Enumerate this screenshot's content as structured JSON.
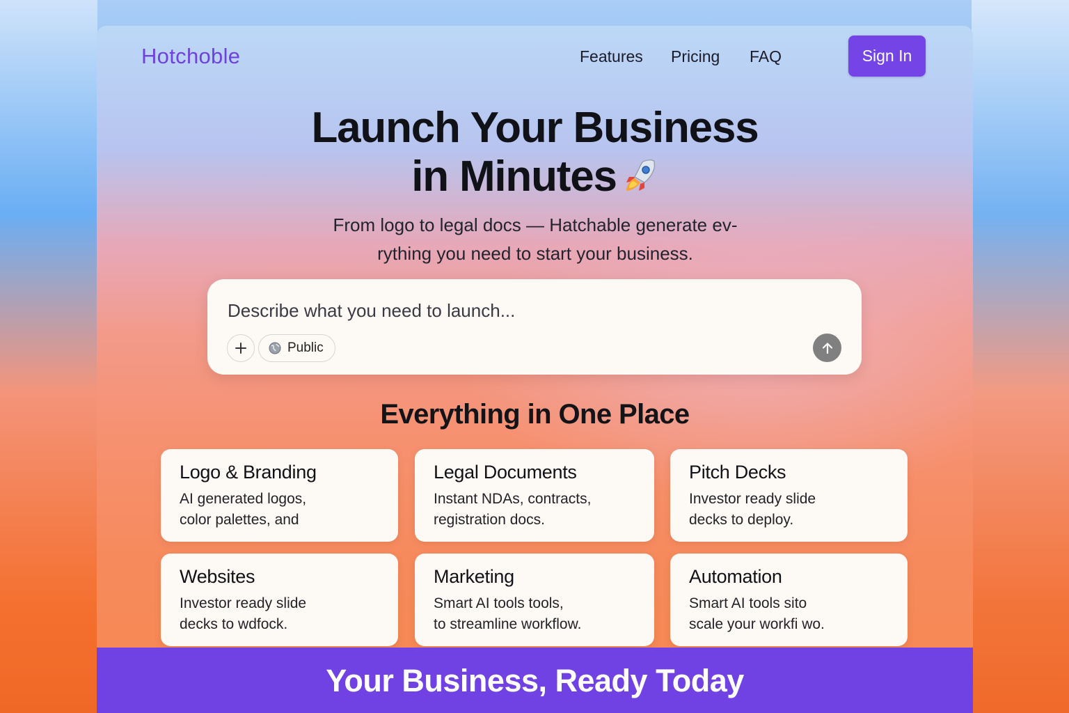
{
  "brand": {
    "name": "Hotchoble",
    "accent_color": "#7544e6"
  },
  "nav": {
    "links": [
      {
        "label": "Features"
      },
      {
        "label": "Pricing"
      },
      {
        "label": "FAQ"
      }
    ],
    "sign_in_label": "Sign In"
  },
  "hero": {
    "title_line1": "Launch Your Business",
    "title_line2": "in Minutes",
    "title_icon": "rocket-icon",
    "subtitle_line1": "From logo to legal docs — Hatchable generate ev-",
    "subtitle_line2": "rything you need to start your business."
  },
  "prompt": {
    "placeholder": "Describe what you need to launch...",
    "add_icon": "plus-icon",
    "visibility_icon": "globe-icon",
    "visibility_label": "Public",
    "send_icon": "arrow-up-icon"
  },
  "features": {
    "title": "Everything in One Place",
    "cards": [
      {
        "title": "Logo & Branding",
        "description": "AI generated logos,\ncolor palettes, and"
      },
      {
        "title": "Legal Documents",
        "description": "Instant NDAs, contracts,\nregistration docs."
      },
      {
        "title": "Pitch Decks",
        "description": "Investor ready slide\ndecks to deploy."
      },
      {
        "title": "Websites",
        "description": "Investor ready slide\ndecks to wdfock."
      },
      {
        "title": "Marketing",
        "description": "Smart AI tools tools,\nto streamline workflow."
      },
      {
        "title": "Automation",
        "description": "Smart AI tools sito\nscale your workfi wo."
      }
    ]
  },
  "footer": {
    "title": "Your Business, Ready Today",
    "band_color": "#7142e3"
  }
}
